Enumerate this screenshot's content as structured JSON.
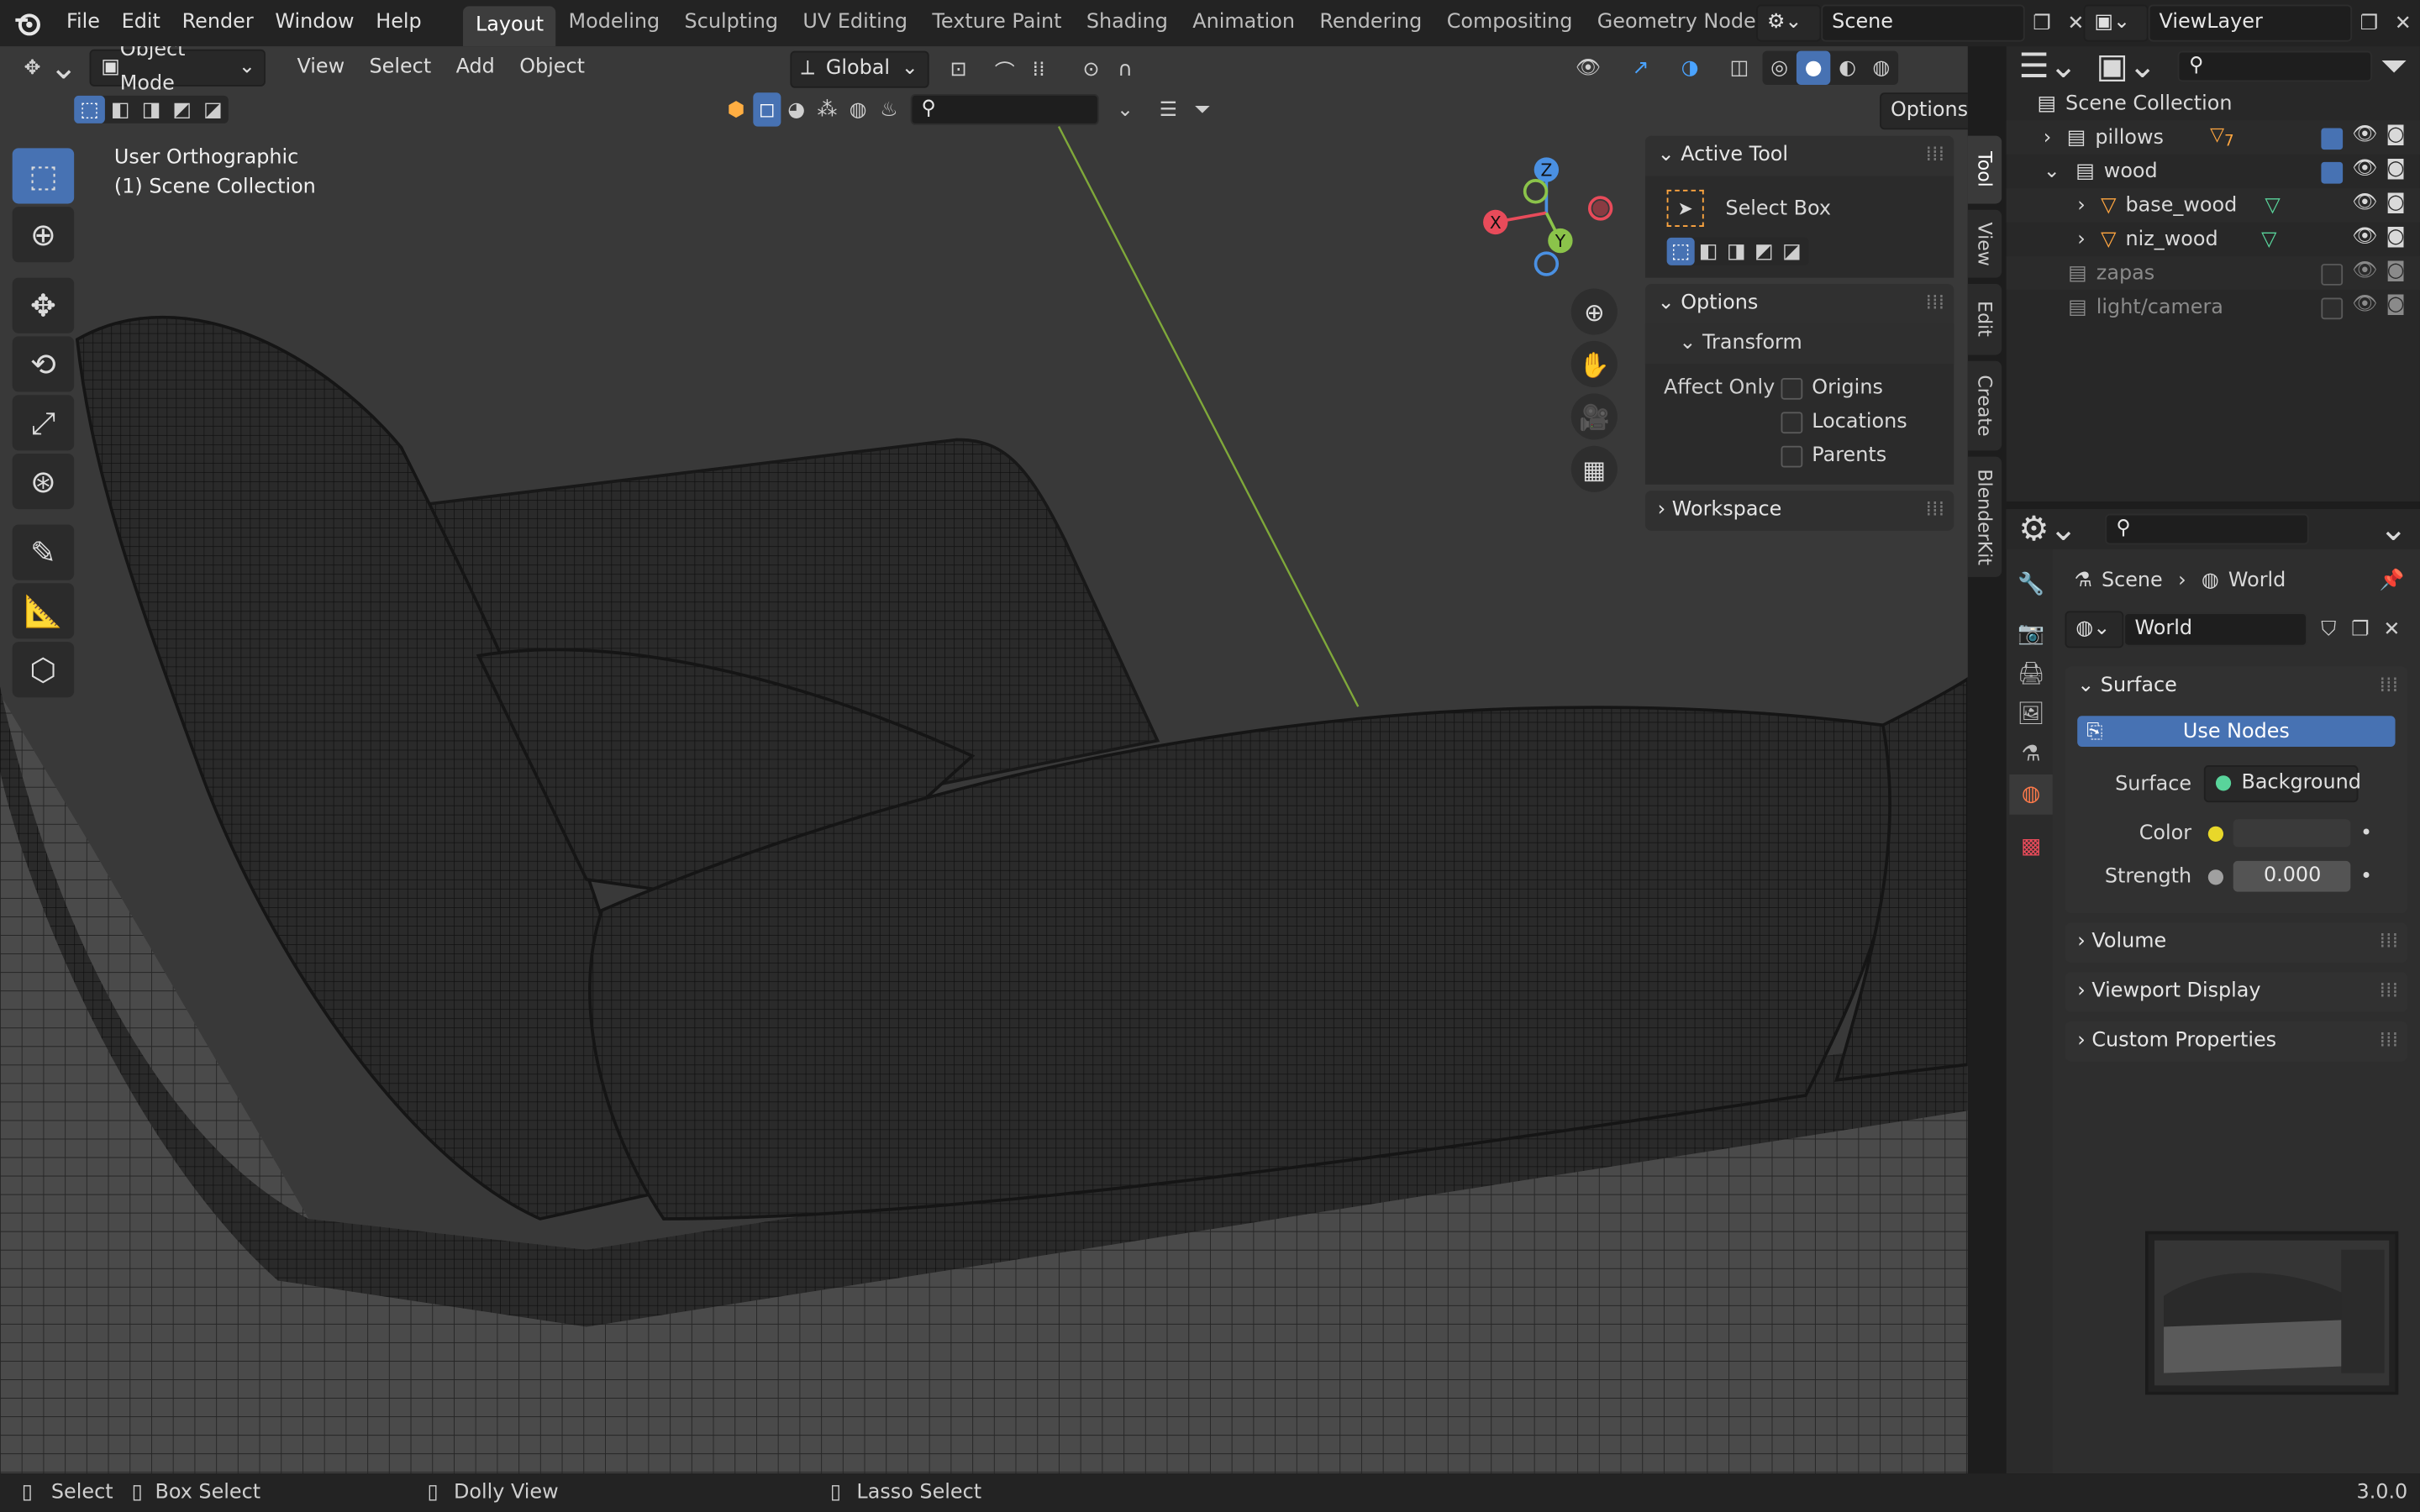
{
  "colors": {
    "accent": "#4772b3",
    "axis_x": "#e84b5a",
    "axis_y": "#8bc34a",
    "axis_z": "#4a90e2",
    "world_icon": "#ff6b4a"
  },
  "topbar": {
    "menus": [
      "File",
      "Edit",
      "Render",
      "Window",
      "Help"
    ],
    "workspaces": [
      "Layout",
      "Modeling",
      "Sculpting",
      "UV Editing",
      "Texture Paint",
      "Shading",
      "Animation",
      "Rendering",
      "Compositing",
      "Geometry Nodes"
    ],
    "scene_name": "Scene",
    "view_layer": "ViewLayer"
  },
  "viewport": {
    "mode": "Object Mode",
    "menus": [
      "View",
      "Select",
      "Add",
      "Object"
    ],
    "orientation": "Global",
    "options_label": "Options",
    "view_name": "User Orthographic",
    "collection_label": "(1) Scene Collection",
    "gizmo": {
      "x": "X",
      "y": "Y",
      "z": "Z"
    }
  },
  "npanel": {
    "active_tool_title": "Active Tool",
    "tool_name": "Select Box",
    "options_title": "Options",
    "transform_title": "Transform",
    "affect_only": "Affect Only",
    "checks": [
      "Origins",
      "Locations",
      "Parents"
    ],
    "workspace_title": "Workspace",
    "tabs": [
      "Tool",
      "View",
      "Edit",
      "Create",
      "BlenderKit"
    ]
  },
  "outliner": {
    "root": "Scene Collection",
    "items": [
      {
        "name": "pillows",
        "badge": "7"
      },
      {
        "name": "wood"
      },
      {
        "name": "base_wood"
      },
      {
        "name": "niz_wood"
      },
      {
        "name": "zapas"
      },
      {
        "name": "light/camera"
      }
    ]
  },
  "properties": {
    "breadcrumb_scene": "Scene",
    "breadcrumb_world": "World",
    "world_name": "World",
    "surface_panel": "Surface",
    "use_nodes": "Use Nodes",
    "surface_label": "Surface",
    "surface_value": "Background",
    "color_label": "Color",
    "strength_label": "Strength",
    "strength_value": "0.000",
    "collapsed_panels": [
      "Volume",
      "Viewport Display",
      "Custom Properties"
    ]
  },
  "statusbar": {
    "items": [
      "Select",
      "Box Select",
      "Dolly View",
      "Lasso Select"
    ],
    "version": "3.0.0"
  }
}
